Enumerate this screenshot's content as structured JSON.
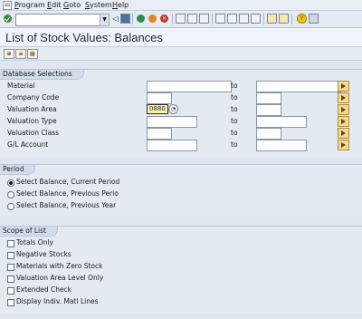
{
  "menubar": {
    "items": [
      {
        "label": "Program",
        "underline": "P",
        "rest": "rogram"
      },
      {
        "label": "Edit",
        "underline": "E",
        "rest": "dit"
      },
      {
        "label": "Goto",
        "underline": "G",
        "rest": "oto"
      },
      {
        "label": "System",
        "underline": "S",
        "rest": "ystem"
      },
      {
        "label": "Help",
        "underline": "H",
        "rest": "elp"
      }
    ]
  },
  "toolbar": {
    "command_value": ""
  },
  "title": "List of Stock Values: Balances",
  "sections": {
    "db": {
      "title": "Database Selections",
      "to_label": "to",
      "rows": [
        {
          "label": "Material",
          "from": "",
          "to": ""
        },
        {
          "label": "Company Code",
          "from": "",
          "to": ""
        },
        {
          "label": "Valuation Area",
          "from": "0880",
          "to": ""
        },
        {
          "label": "Valuation Type",
          "from": "",
          "to": ""
        },
        {
          "label": "Valuation Class",
          "from": "",
          "to": ""
        },
        {
          "label": "G/L Account",
          "from": "",
          "to": ""
        }
      ]
    },
    "period": {
      "title": "Period",
      "options": [
        {
          "label": "Select Balance, Current Period",
          "selected": true
        },
        {
          "label": "Select Balance, Previous Perio",
          "selected": false
        },
        {
          "label": "Select Balance, Previous Year",
          "selected": false
        }
      ]
    },
    "scope": {
      "title": "Scope of List",
      "options": [
        {
          "label": "Totals Only",
          "checked": false
        },
        {
          "label": "Negative Stocks",
          "checked": false
        },
        {
          "label": "Materials with Zero Stock",
          "checked": false
        },
        {
          "label": "Valuation Area Level Only",
          "checked": false
        },
        {
          "label": "Extended Check",
          "checked": false
        },
        {
          "label": "Display Indiv. Matl Lines",
          "checked": false
        }
      ]
    }
  },
  "colors": {
    "accent": "#3a8a3a",
    "background": "#dfe6ef",
    "multiple_selection": "#f3d893"
  },
  "icons": [
    "menu-icon",
    "enter-icon",
    "save-icon",
    "back-icon",
    "exit-icon",
    "cancel-icon",
    "print-icon",
    "find-icon",
    "find-next-icon",
    "first-page-icon",
    "prev-page-icon",
    "next-page-icon",
    "last-page-icon",
    "new-session-icon",
    "shortcut-icon",
    "help-icon",
    "layout-icon",
    "execute-icon",
    "variant-icon",
    "selection-options-icon"
  ]
}
